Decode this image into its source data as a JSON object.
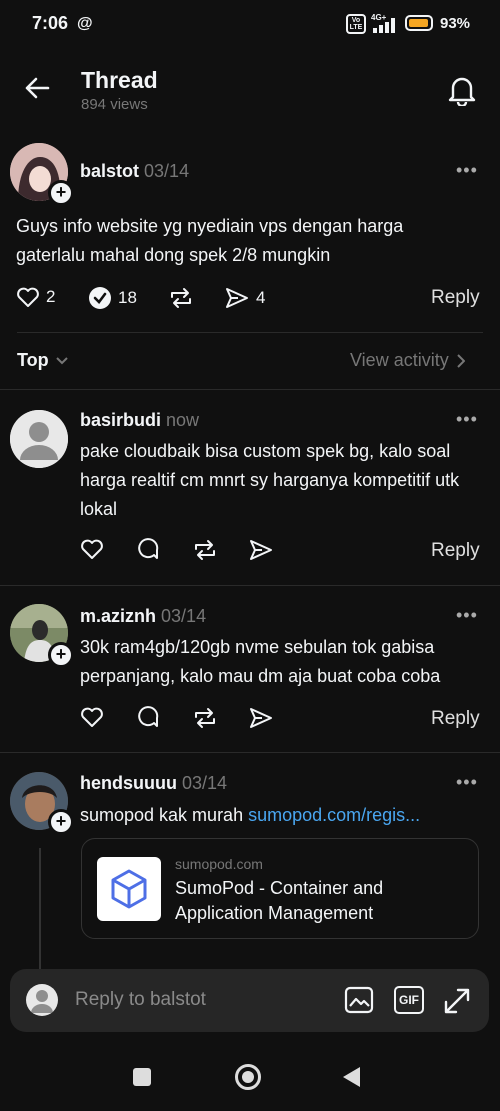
{
  "status_bar": {
    "time": "7:06",
    "volte": "Vo LTE",
    "network": "4G+",
    "battery": "93%",
    "battery_level": 0.93
  },
  "header": {
    "title": "Thread",
    "views": "894 views"
  },
  "main_post": {
    "author": "balstot",
    "date": "03/14",
    "text": "Guys info website yg nyediain vps dengan harga gaterlalu mahal dong spek 2/8 mungkin",
    "likes": "2",
    "reposts_badge": "18",
    "shares": "4",
    "reply_label": "Reply"
  },
  "sort": {
    "label": "Top",
    "view_activity": "View activity"
  },
  "replies": [
    {
      "author": "basirbudi",
      "date": "now",
      "text": "pake cloudbaik bisa custom spek bg, kalo soal harga realtif cm mnrt sy harganya kompetitif utk lokal",
      "reply_label": "Reply"
    },
    {
      "author": "m.aziznh",
      "date": "03/14",
      "text": "30k ram4gb/120gb nvme sebulan tok gabisa perpanjang, kalo mau dm aja buat coba coba",
      "reply_label": "Reply"
    },
    {
      "author": "hendsuuuu",
      "date": "03/14",
      "text": "sumopod kak murah",
      "link": "sumopod.com/regis...",
      "card": {
        "domain": "sumopod.com",
        "title": "SumoPod - Container and Application Management"
      }
    }
  ],
  "composer": {
    "placeholder": "Reply to balstot",
    "gif_label": "GIF"
  },
  "colors": {
    "background": "#101010",
    "link": "#4aa6f0",
    "battery": "#f5a623"
  }
}
